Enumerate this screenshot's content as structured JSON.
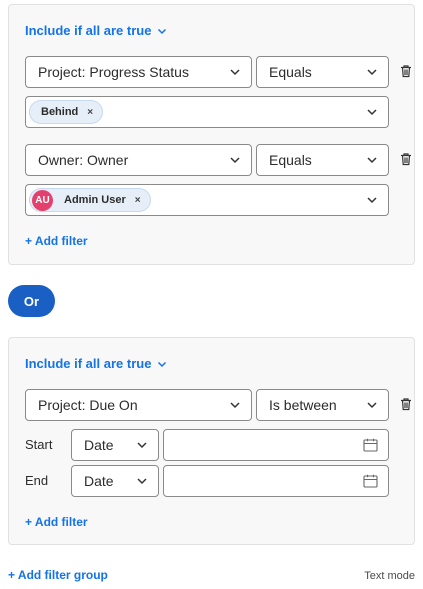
{
  "groups": [
    {
      "mode_label": "Include if all are true",
      "filters": [
        {
          "field": "Project: Progress Status",
          "operator": "Equals",
          "values": [
            "Behind"
          ]
        },
        {
          "field": "Owner: Owner",
          "operator": "Equals",
          "values": [
            {
              "initials": "AU",
              "name": "Admin User"
            }
          ]
        }
      ],
      "add_filter_label": "+ Add filter"
    },
    {
      "mode_label": "Include if all are true",
      "filters": [
        {
          "field": "Project: Due On",
          "operator": "Is between",
          "start_label": "Start",
          "start_type": "Date",
          "start_value": "",
          "end_label": "End",
          "end_type": "Date",
          "end_value": ""
        }
      ],
      "add_filter_label": "+ Add filter"
    }
  ],
  "or_label": "Or",
  "add_group_label": "+ Add filter group",
  "text_mode_label": "Text mode",
  "colors": {
    "accent": "#1473e6",
    "or_button": "#1a5fc4",
    "avatar": "#e3406d"
  }
}
